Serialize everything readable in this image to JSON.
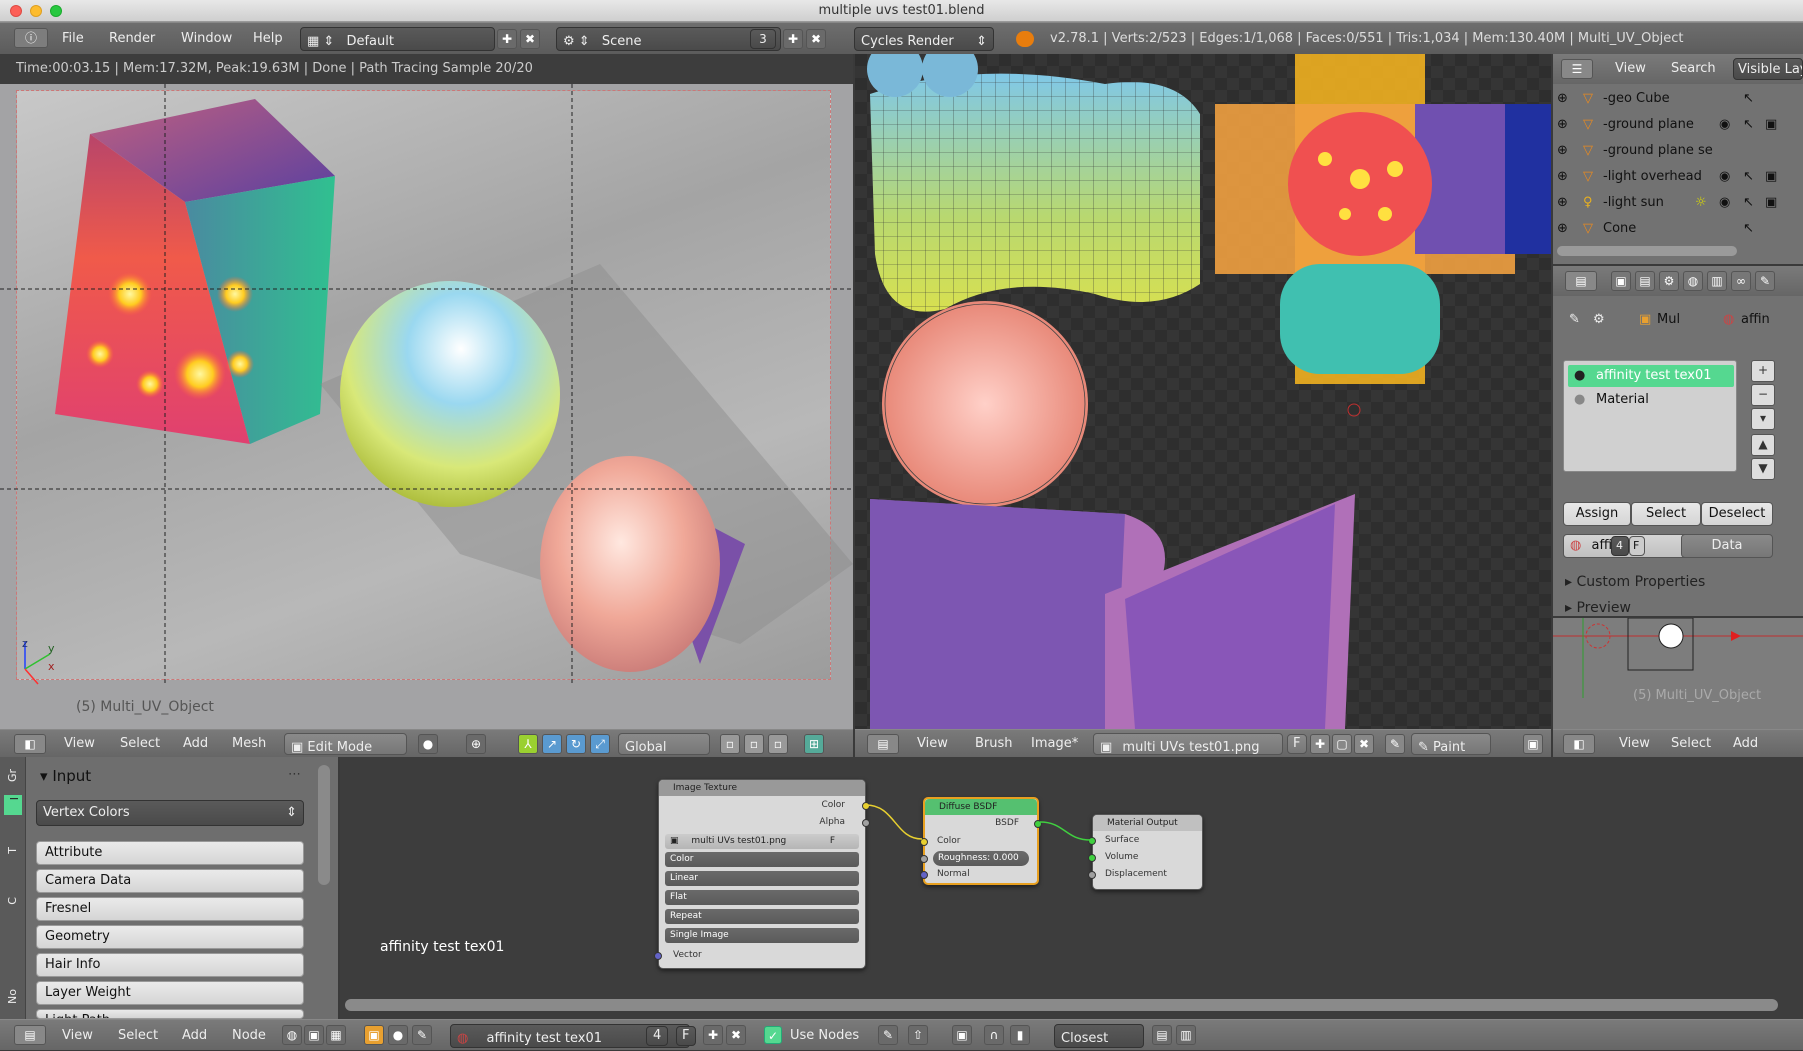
{
  "window": {
    "title": "multiple uvs test01.blend"
  },
  "topbar": {
    "menus": [
      "File",
      "Render",
      "Window",
      "Help"
    ],
    "layout": "Default",
    "scene": "Scene",
    "scene_count": "3",
    "engine": "Cycles Render",
    "stats": "v2.78.1 | Verts:2/523 | Edges:1/1,068 | Faces:0/551 | Tris:1,034 | Mem:130.40M | Multi_UV_Object"
  },
  "viewport": {
    "status": "Time:00:03.15 | Mem:17.32M, Peak:19.63M | Done | Path Tracing Sample 20/20",
    "object_label": "(5) Multi_UV_Object",
    "axis_x": "x",
    "axis_y": "y",
    "axis_z": "z"
  },
  "viewport_header": {
    "view": "View",
    "select": "Select",
    "add": "Add",
    "mesh": "Mesh",
    "mode": "Edit Mode",
    "orientation": "Global"
  },
  "image_header": {
    "view": "View",
    "brush": "Brush",
    "image": "Image*",
    "image_name": "multi UVs test01.png",
    "f": "F",
    "mode": "Paint"
  },
  "outliner": {
    "view": "View",
    "search": "Search",
    "filter": "Visible Lay",
    "items": [
      {
        "name": "-geo Cube",
        "icon": "mesh-icon"
      },
      {
        "name": "-ground plane",
        "icon": "mesh-icon"
      },
      {
        "name": "-ground plane se",
        "icon": "mesh-icon"
      },
      {
        "name": "-light overhead",
        "icon": "mesh-icon"
      },
      {
        "name": "-light sun",
        "icon": "lamp-icon"
      },
      {
        "name": "Cone",
        "icon": "mesh-icon"
      }
    ]
  },
  "properties": {
    "crumb_object": "Mul",
    "crumb_material": "affin",
    "slots": [
      "affinity test tex01",
      "Material"
    ],
    "assign": "Assign",
    "select": "Select",
    "deselect": "Deselect",
    "material_name": "affi",
    "users": "4",
    "f": "F",
    "data": "Data",
    "custom_props": "Custom Properties",
    "preview": "Preview"
  },
  "mini_view": {
    "label": "(5) Multi_UV_Object"
  },
  "node_sidebar": {
    "panel_title": "Input",
    "dropdown": "Vertex Colors",
    "items": [
      "Attribute",
      "Camera Data",
      "Fresnel",
      "Geometry",
      "Hair Info",
      "Layer Weight",
      "Light Path"
    ],
    "tabs": [
      "Gr",
      "I",
      "T",
      "C",
      "No"
    ]
  },
  "nodes": {
    "image_texture": {
      "title": "Image Texture",
      "out_color": "Color",
      "out_alpha": "Alpha",
      "image": "multi UVs test01.png",
      "f": "F",
      "color": "Color",
      "interp": "Linear",
      "proj": "Flat",
      "ext": "Repeat",
      "source": "Single Image",
      "vector": "Vector"
    },
    "diffuse": {
      "title": "Diffuse BSDF",
      "out": "BSDF",
      "color": "Color",
      "roughness": "Roughness:",
      "roughness_val": "0.000",
      "normal": "Normal"
    },
    "output": {
      "title": "Material Output",
      "surface": "Surface",
      "volume": "Volume",
      "displacement": "Displacement"
    },
    "material_label": "affinity test tex01"
  },
  "node_header": {
    "view": "View",
    "select": "Select",
    "add": "Add",
    "node": "Node",
    "material": "affinity test tex01",
    "users": "4",
    "f": "F",
    "use_nodes": "Use Nodes",
    "interp": "Closest"
  }
}
